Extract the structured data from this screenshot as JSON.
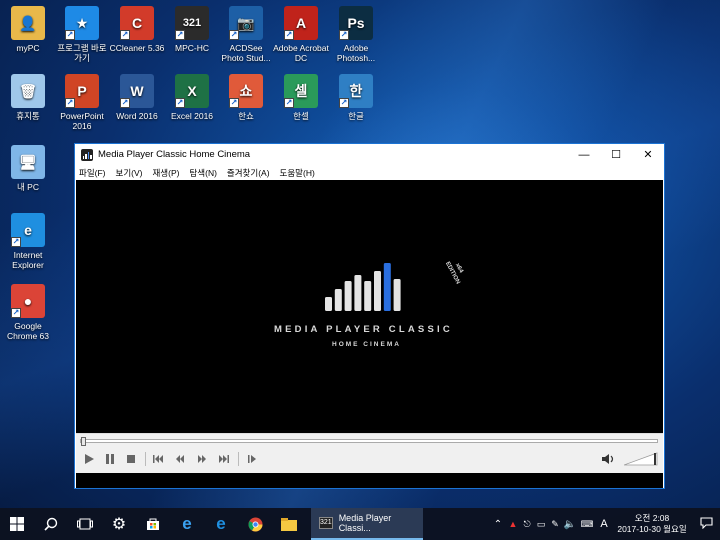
{
  "desktop": {
    "icons": [
      {
        "label": "myPC",
        "icon": "folder-user-icon",
        "color": "#e8b84a"
      },
      {
        "label": "프로그램 바로가기",
        "icon": "star-icon",
        "color": "#1e8ae6"
      },
      {
        "label": "CCleaner 5.36",
        "icon": "ccleaner-icon",
        "color": "#d23b2a"
      },
      {
        "label": "MPC-HC",
        "icon": "mpc-hc-icon",
        "color": "#2b2b2b"
      },
      {
        "label": "ACDSee Photo Stud...",
        "icon": "acdsee-icon",
        "color": "#1d5fa6"
      },
      {
        "label": "Adobe Acrobat DC",
        "icon": "acrobat-icon",
        "color": "#c0231b"
      },
      {
        "label": "Adobe Photosh...",
        "icon": "photoshop-icon",
        "color": "#0c2d42"
      },
      {
        "label": "휴지통",
        "icon": "recycle-bin-icon",
        "color": "#9fc7ea"
      },
      {
        "label": "PowerPoint 2016",
        "icon": "powerpoint-icon",
        "color": "#d04525"
      },
      {
        "label": "Word 2016",
        "icon": "word-icon",
        "color": "#2b5797"
      },
      {
        "label": "Excel 2016",
        "icon": "excel-icon",
        "color": "#1e7145"
      },
      {
        "label": "한쇼",
        "icon": "hanshow-icon",
        "color": "#e05a3a"
      },
      {
        "label": "한셀",
        "icon": "hancell-icon",
        "color": "#2a9a5a"
      },
      {
        "label": "한글",
        "icon": "hangul-icon",
        "color": "#2f7fc4"
      },
      {
        "label": "내 PC",
        "icon": "this-pc-icon",
        "color": "#7fb6e8"
      },
      {
        "label": "Internet Explorer",
        "icon": "internet-explorer-icon",
        "color": "#1f8fe0"
      },
      {
        "label": "Google Chrome 63",
        "icon": "chrome-icon",
        "color": "#db4437"
      }
    ]
  },
  "window": {
    "title": "Media Player Classic Home Cinema",
    "controls": {
      "minimize": "—",
      "maximize": "☐",
      "close": "✕"
    },
    "menu": [
      "파일(F)",
      "보기(V)",
      "재생(P)",
      "탐색(N)",
      "즐겨찾기(A)",
      "도움말(H)"
    ],
    "logo": {
      "title": "MEDIA PLAYER CLASSIC",
      "subtitle": "HOME CINEMA",
      "edition_top": "x64",
      "edition_bottom": "EDITION",
      "accent": "#2a6fe0"
    },
    "playback": {
      "position_fraction": 0.0,
      "buttons": [
        "play-icon",
        "pause-icon",
        "stop-icon",
        "skip-back-icon",
        "rewind-icon",
        "fast-forward-icon",
        "skip-forward-icon",
        "frame-step-icon"
      ],
      "volume_icon": "speaker-icon"
    }
  },
  "taskbar": {
    "active_app": "Media Player Classi...",
    "clock": {
      "time": "오전 2:08",
      "date": "2017-10-30 월요일"
    },
    "ime": "A"
  }
}
